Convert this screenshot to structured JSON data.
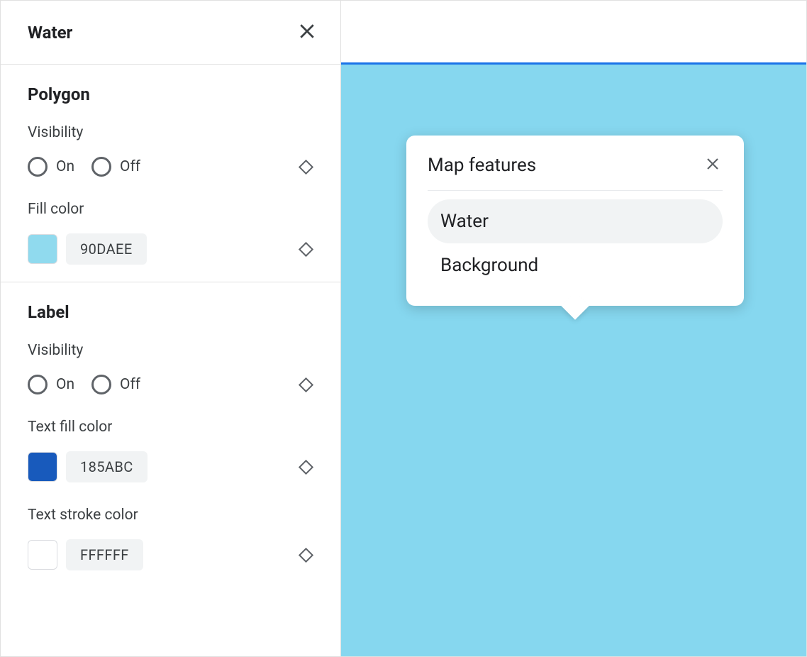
{
  "sidebar": {
    "title": "Water",
    "sections": {
      "polygon": {
        "title": "Polygon",
        "visibility_label": "Visibility",
        "on_label": "On",
        "off_label": "Off",
        "fill_color_label": "Fill color",
        "fill_color_hex": "90DAEE",
        "fill_color_value": "#90DAEE"
      },
      "label": {
        "title": "Label",
        "visibility_label": "Visibility",
        "on_label": "On",
        "off_label": "Off",
        "text_fill_label": "Text fill color",
        "text_fill_hex": "185ABC",
        "text_fill_value": "#185ABC",
        "text_stroke_label": "Text stroke color",
        "text_stroke_hex": "FFFFFF",
        "text_stroke_value": "#FFFFFF"
      }
    }
  },
  "preview": {
    "popover": {
      "title": "Map features",
      "items": [
        {
          "label": "Water",
          "selected": true
        },
        {
          "label": "Background",
          "selected": false
        }
      ]
    },
    "accent_color": "#1a73e8",
    "water_color": "#86d7ef"
  }
}
